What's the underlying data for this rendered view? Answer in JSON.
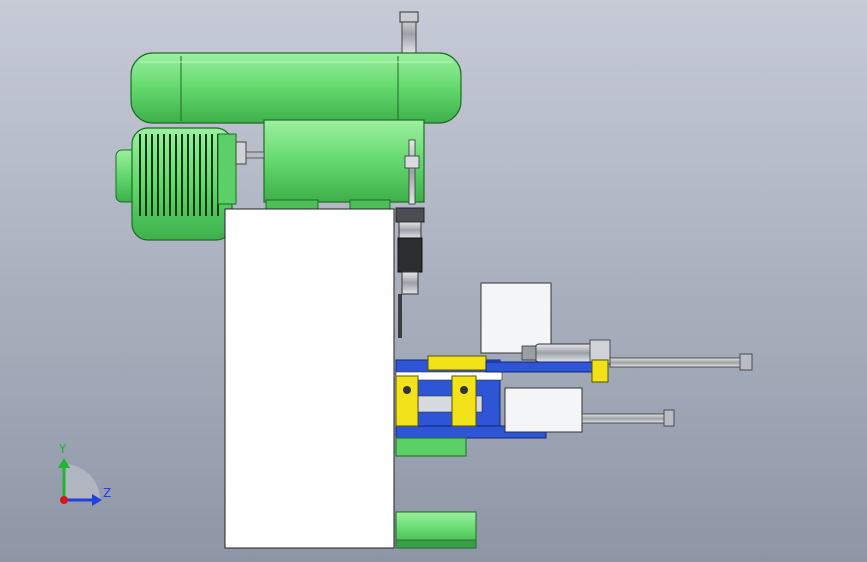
{
  "colors": {
    "bg_top": "#c6cbd6",
    "bg_bottom": "#8e96a6",
    "green": "#6fe07a",
    "green_dark": "#2f8a3a",
    "white_part": "#ffffff",
    "blue": "#2d55d6",
    "yellow": "#f2e21a",
    "steel": "#b8bcc2",
    "steel_dark": "#5b5f66",
    "axis_y": "#1fb52e",
    "axis_z": "#2340e0",
    "axis_x": "#d01a1a"
  },
  "triad": {
    "y_label": "Y",
    "z_label": "Z"
  }
}
